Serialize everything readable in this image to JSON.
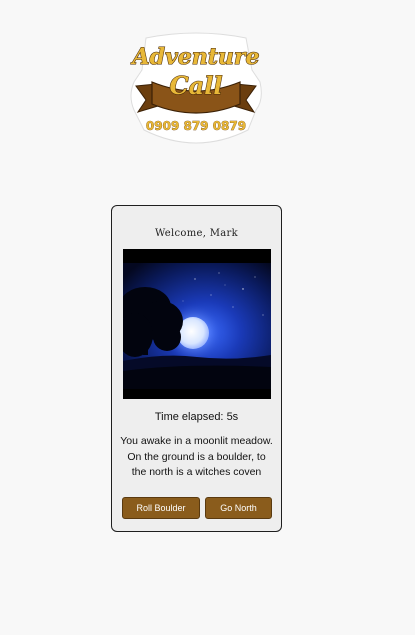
{
  "logo": {
    "line1": "Adventure",
    "line2": "Call",
    "phone": "0909 879 0879"
  },
  "game": {
    "welcome": "Welcome, Mark",
    "scene_alt": "Moonlit meadow with a tree silhouette",
    "timer_label": "Time elapsed:",
    "timer_value": "5s",
    "story": "You awake in a moonlit meadow. On the ground is a boulder, to the north is a witches coven",
    "actions": [
      {
        "label": "Roll Boulder"
      },
      {
        "label": "Go North"
      }
    ]
  },
  "colors": {
    "button_bg": "#8a5c1c",
    "logo_gold": "#e0b23a",
    "logo_banner": "#7a4a12",
    "sky": "#0a1a5c"
  }
}
